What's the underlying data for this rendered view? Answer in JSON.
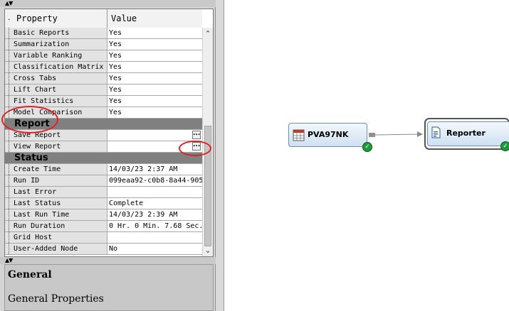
{
  "property_grid": {
    "header": {
      "property": "Property",
      "value": "Value"
    },
    "rows": [
      {
        "type": "prop",
        "label": "Basic Reports",
        "value": "Yes"
      },
      {
        "type": "prop",
        "label": "Summarization",
        "value": "Yes"
      },
      {
        "type": "prop",
        "label": "Variable Ranking",
        "value": "Yes"
      },
      {
        "type": "prop",
        "label": "Classification Matrix",
        "value": "Yes"
      },
      {
        "type": "prop",
        "label": "Cross Tabs",
        "value": "Yes"
      },
      {
        "type": "prop",
        "label": "Lift Chart",
        "value": "Yes"
      },
      {
        "type": "prop",
        "label": "Fit Statistics",
        "value": "Yes"
      },
      {
        "type": "prop",
        "label": "Model Comparison",
        "value": "Yes"
      },
      {
        "type": "section",
        "label": "Report"
      },
      {
        "type": "prop",
        "label": "Save Report",
        "value": "",
        "ellipsis": "..."
      },
      {
        "type": "prop",
        "label": "View Report",
        "value": "",
        "ellipsis": "..."
      },
      {
        "type": "section",
        "label": "Status"
      },
      {
        "type": "prop",
        "label": "Create Time",
        "value": "14/03/23 2:37 AM"
      },
      {
        "type": "prop",
        "label": "Run ID",
        "value": "099eaa92-c0b8-8a44-905"
      },
      {
        "type": "prop",
        "label": "Last Error",
        "value": ""
      },
      {
        "type": "prop",
        "label": "Last Status",
        "value": "Complete"
      },
      {
        "type": "prop",
        "label": "Last Run Time",
        "value": "14/03/23 2:39 AM"
      },
      {
        "type": "prop",
        "label": "Run Duration",
        "value": "0 Hr. 0 Min. 7.68 Sec."
      },
      {
        "type": "prop",
        "label": "Grid Host",
        "value": ""
      },
      {
        "type": "prop",
        "label": "User-Added Node",
        "value": "No"
      }
    ]
  },
  "general_panel": {
    "title": "General",
    "description": "General Properties"
  },
  "diagram": {
    "nodes": [
      {
        "label": "PVA97NK",
        "icon": "data-table-icon",
        "status": "complete"
      },
      {
        "label": "Reporter",
        "icon": "report-document-icon",
        "status": "complete"
      }
    ]
  },
  "colors": {
    "section_bg": "#808080",
    "node_border": "#6f8fb0",
    "status_ok": "#1e9a3a",
    "annotation": "#e02020"
  }
}
